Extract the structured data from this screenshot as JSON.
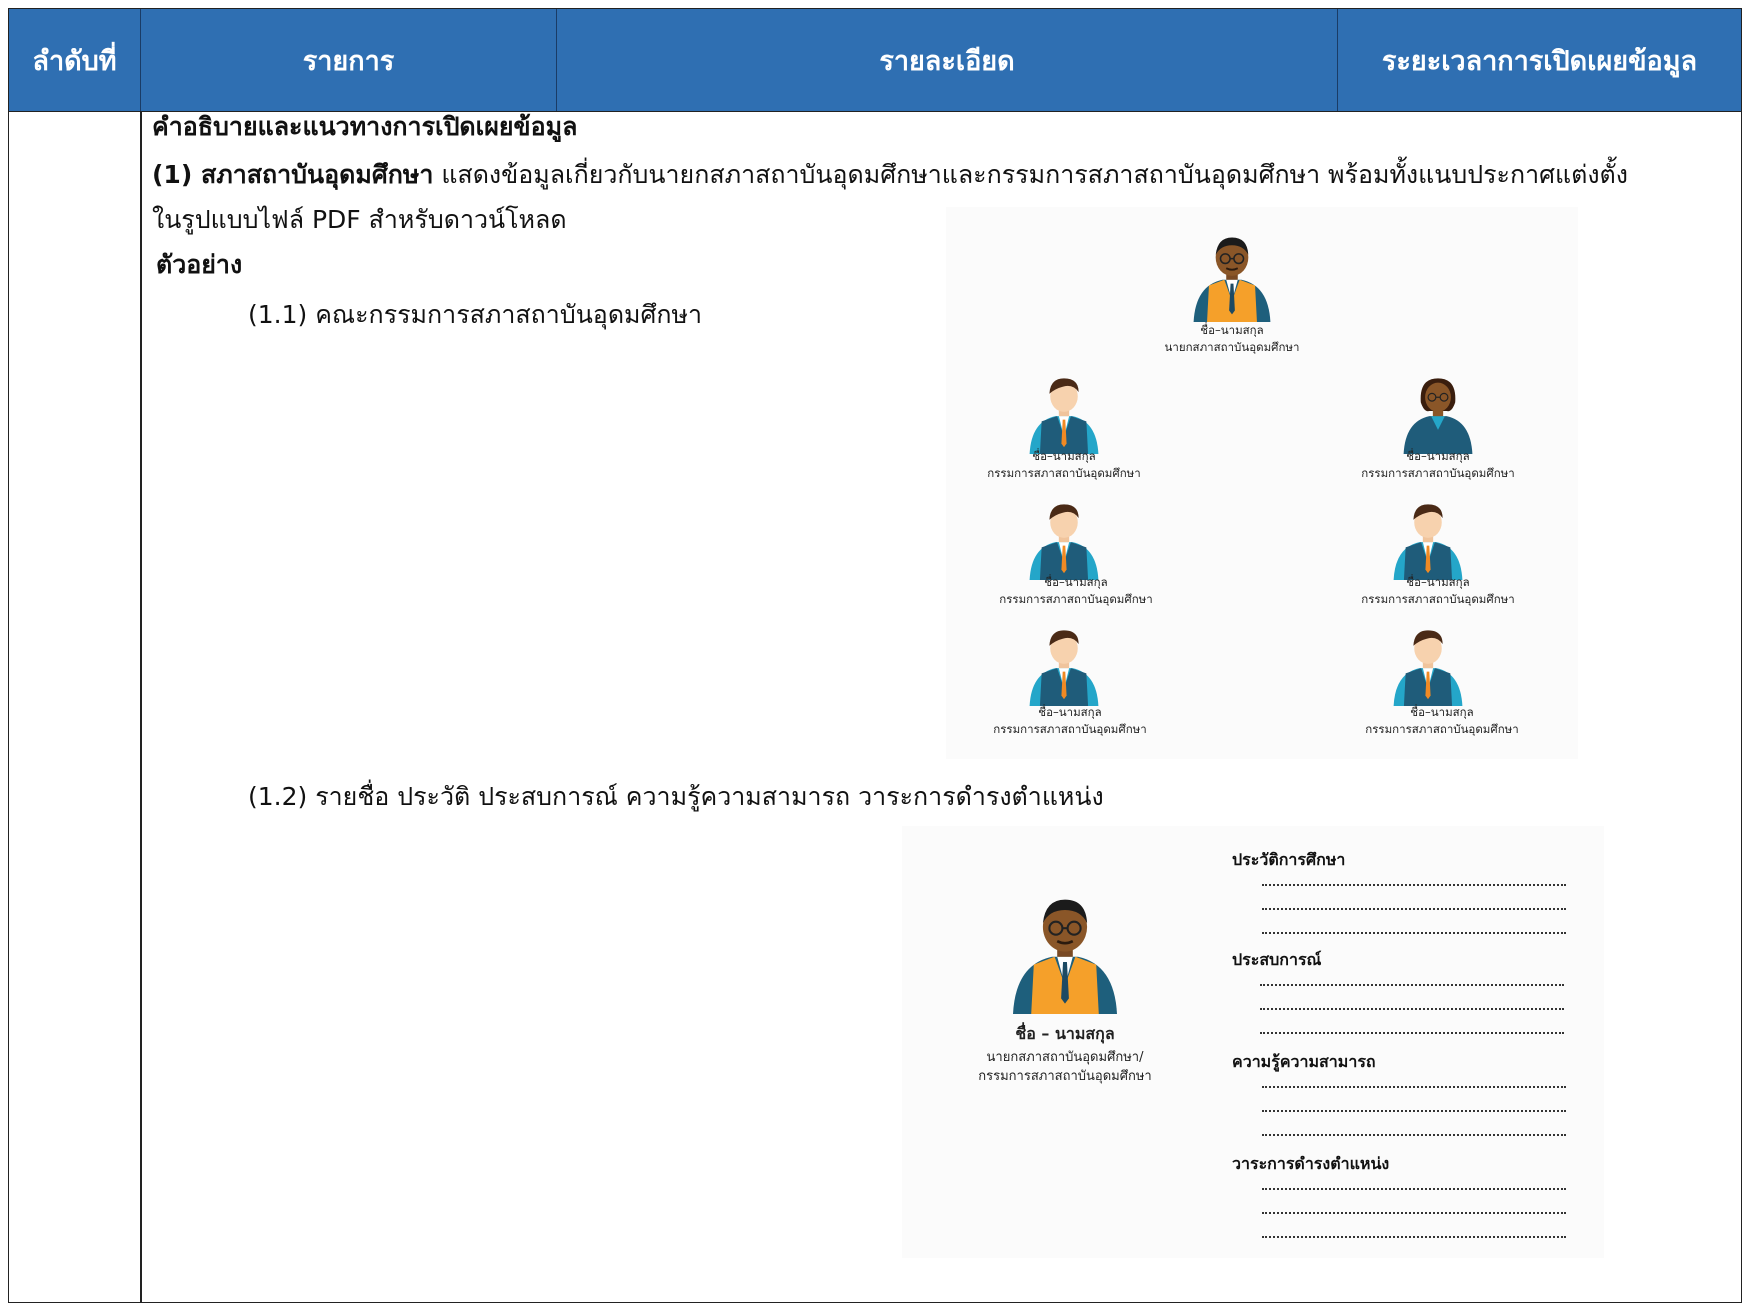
{
  "header": {
    "col1": "ลำดับที่",
    "col2": "รายการ",
    "col3": "รายละเอียด",
    "col4": "ระยะเวลาการเปิดเผยข้อมูล"
  },
  "body": {
    "section_title": "คำอธิบายและแนวทางการเปิดเผยข้อมูล",
    "item1_label": "(1) สภาสถาบันอุดมศึกษา",
    "item1_text": " แสดงข้อมูลเกี่ยวกับนายกสภาสถาบันอุดมศึกษาและกรรมการสภาสถาบันอุดมศึกษา พร้อมทั้งแนบประกาศแต่งตั้ง",
    "item1_text2": "ในรูปแบบไฟล์ PDF สำหรับดาวน์โหลด",
    "example_label": "ตัวอย่าง",
    "sub1": "(1.1) คณะกรรมการสภาสถาบันอุดมศึกษา",
    "sub2": "(1.2) รายชื่อ ประวัติ ประสบการณ์ ความรู้ความสามารถ วาระการดำรงตำแหน่ง"
  },
  "figure1": {
    "chair_name": "ชื่อ–นามสกุล",
    "chair_role": "นายกสภาสถาบันอุดมศึกษา",
    "member_name": "ชื่อ–นามสกุล",
    "member_role": "กรรมการสภาสถาบันอุดมศึกษา"
  },
  "figure2": {
    "name": "ชื่อ – นามสกุล",
    "role_line1": "นายกสภาสถาบันอุดมศึกษา/",
    "role_line2": "กรรมการสภาสถาบันอุดมศึกษา",
    "heading_education": "ประวัติการศึกษา",
    "heading_experience": "ประสบการณ์",
    "heading_ability": "ความรู้ความสามารถ",
    "heading_term": "วาระการดำรงตำแหน่ง"
  },
  "colors": {
    "header_bg": "#2f6fb2",
    "vest_orange": "#f5a02a",
    "vest_teal": "#1f7a9c",
    "shirt_teal": "#24a6c9"
  }
}
